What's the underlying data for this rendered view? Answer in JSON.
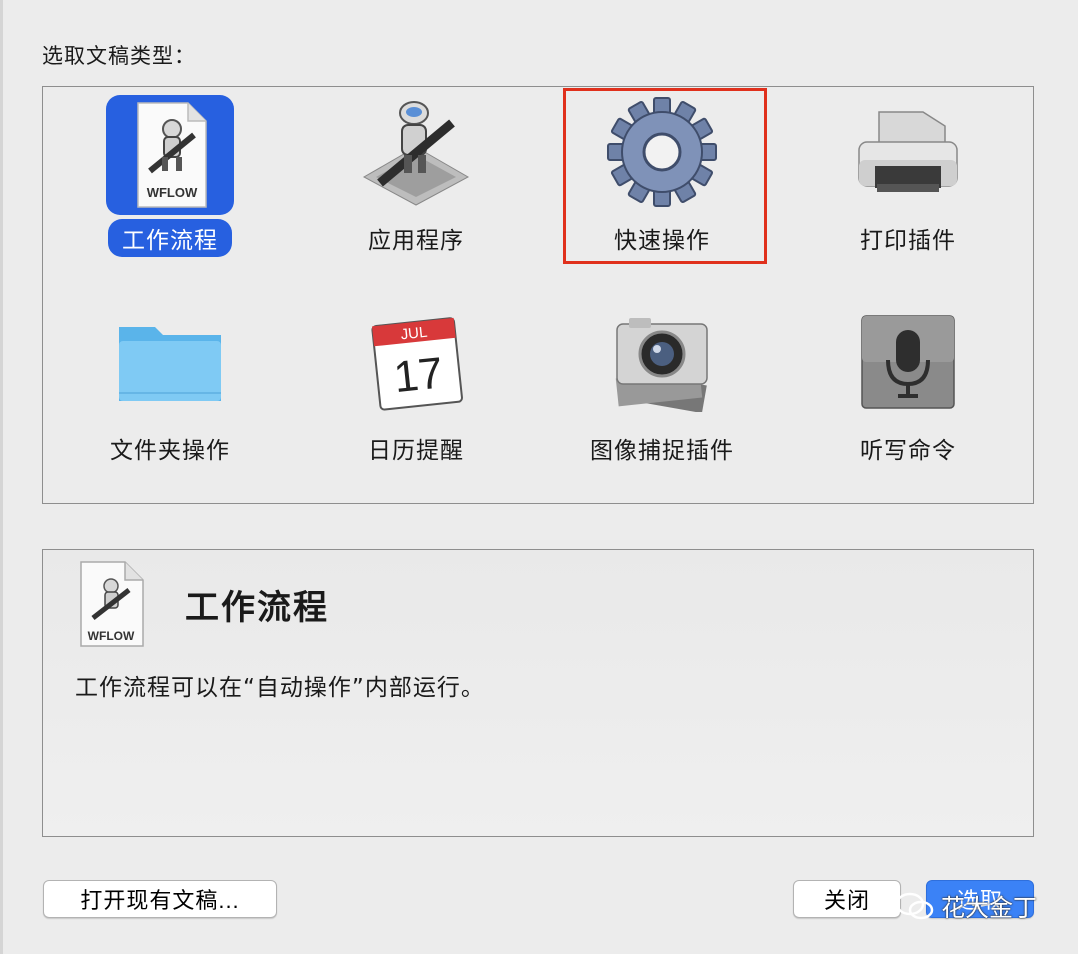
{
  "dialog": {
    "prompt": "选取文稿类型：",
    "tiles": [
      {
        "label": "工作流程",
        "icon": "workflow-document-icon",
        "selected": true,
        "badge": "WFLOW"
      },
      {
        "label": "应用程序",
        "icon": "automator-application-icon",
        "selected": false
      },
      {
        "label": "快速操作",
        "icon": "gear-icon",
        "selected": false
      },
      {
        "label": "打印插件",
        "icon": "printer-icon",
        "selected": false
      },
      {
        "label": "文件夹操作",
        "icon": "folder-icon",
        "selected": false
      },
      {
        "label": "日历提醒",
        "icon": "calendar-icon",
        "selected": false,
        "month": "JUL",
        "day": "17"
      },
      {
        "label": "图像捕捉插件",
        "icon": "camera-icon",
        "selected": false
      },
      {
        "label": "听写命令",
        "icon": "microphone-icon",
        "selected": false
      }
    ],
    "description": {
      "title": "工作流程",
      "text": "工作流程可以在“自动操作”内部运行。",
      "badge": "WFLOW"
    },
    "buttons": {
      "open_existing": "打开现有文稿...",
      "close": "关闭",
      "choose": "选取"
    },
    "watermark": "花大金丁",
    "colors": {
      "accent": "#2760e0",
      "highlight": "#e0301c"
    }
  }
}
